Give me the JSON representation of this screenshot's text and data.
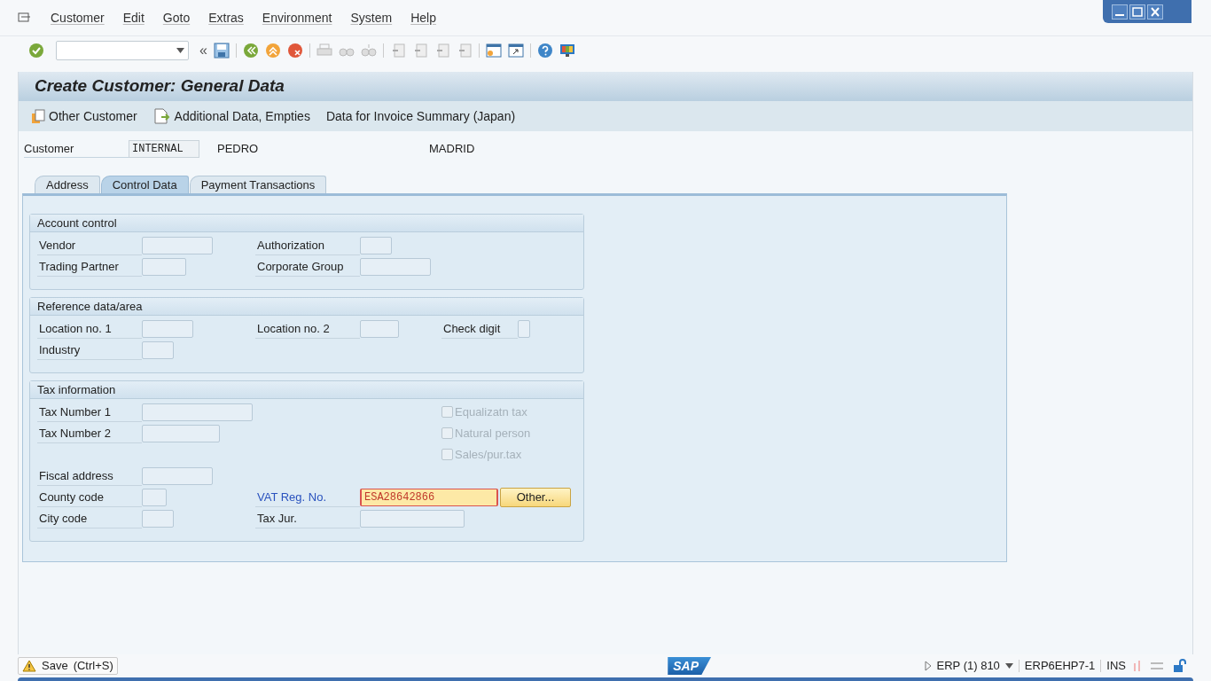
{
  "menu": [
    "Customer",
    "Edit",
    "Goto",
    "Extras",
    "Environment",
    "System",
    "Help"
  ],
  "toolbar": {
    "collapse_glyph": "«"
  },
  "title": "Create Customer: General Data",
  "app_toolbar": [
    {
      "kind": "other",
      "label": "Other Customer"
    },
    {
      "kind": "additional",
      "label": "Additional Data, Empties"
    },
    {
      "kind": "plain",
      "label": "Data for Invoice Summary (Japan)"
    }
  ],
  "header": {
    "label": "Customer",
    "value": "INTERNAL",
    "name": "PEDRO",
    "city": "MADRID"
  },
  "tabs": [
    {
      "label": "Address",
      "selected": false
    },
    {
      "label": "Control Data",
      "selected": true
    },
    {
      "label": "Payment Transactions",
      "selected": false
    }
  ],
  "sections": [
    {
      "title": "Account control",
      "rows": [
        {
          "left": {
            "kind": "field",
            "label": "Vendor"
          },
          "middle": {
            "kind": "field",
            "label": "Authorization"
          }
        },
        {
          "left": {
            "kind": "field",
            "label": "Trading Partner"
          },
          "middle": {
            "kind": "field",
            "label": "Corporate Group"
          }
        }
      ]
    },
    {
      "title": "Reference data/area",
      "rows": [
        {
          "left": {
            "kind": "field",
            "label": "Location no. 1"
          },
          "middle": {
            "kind": "field",
            "label": "Location no. 2"
          },
          "right": {
            "kind": "field",
            "label": "Check digit"
          }
        },
        {
          "left": {
            "kind": "field",
            "label": "Industry"
          }
        }
      ]
    },
    {
      "title": "Tax information",
      "rows": [
        {
          "left": {
            "kind": "field",
            "label": "Tax Number 1"
          },
          "right": {
            "kind": "checkbox",
            "label": "Equalizatn tax",
            "checked": false,
            "disabled": true
          }
        },
        {
          "left": {
            "kind": "field",
            "label": "Tax Number 2"
          },
          "right": {
            "kind": "checkbox",
            "label": "Natural person",
            "checked": false,
            "disabled": true
          }
        },
        {
          "right": {
            "kind": "checkbox",
            "label": "Sales/pur.tax",
            "checked": false,
            "disabled": true
          }
        },
        {
          "left": {
            "kind": "field",
            "label": "Fiscal address"
          }
        },
        {
          "left": {
            "kind": "field",
            "label": "County code"
          },
          "middle": {
            "kind": "field",
            "label": "VAT Reg. No.",
            "value": "ESA28642866",
            "focused": true,
            "button": "Other..."
          }
        },
        {
          "left": {
            "kind": "field",
            "label": "City code"
          },
          "middle": {
            "kind": "field",
            "label": "Tax Jur."
          }
        }
      ]
    }
  ],
  "status": {
    "message": "Save",
    "shortcut": "(Ctrl+S)",
    "logo": "SAP",
    "system": "ERP (1) 810",
    "server": "ERP6EHP7-1",
    "mode": "INS"
  }
}
